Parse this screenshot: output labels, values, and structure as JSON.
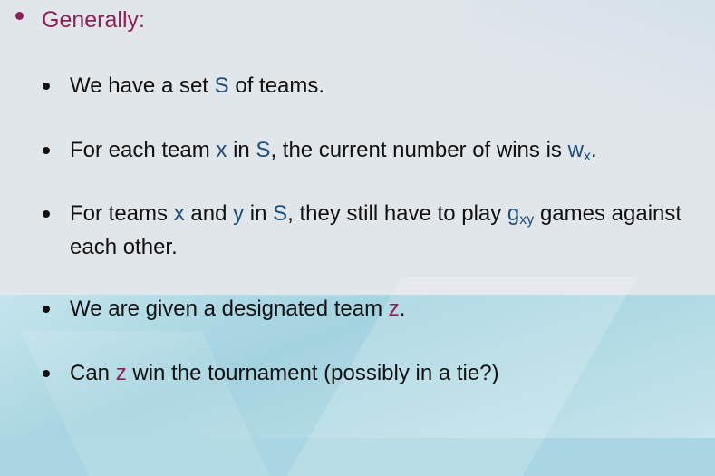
{
  "heading": "Generally:",
  "items": {
    "i1": {
      "a": "We have a set ",
      "s": "S",
      "b": " of teams."
    },
    "i2": {
      "a": "For each team ",
      "x": "x",
      "b": " in ",
      "s": "S",
      "c": ", the current number of wins is ",
      "w": "w",
      "wsub": "x",
      "d": "."
    },
    "i3": {
      "a": "For teams ",
      "x": "x",
      "b": " and ",
      "y": "y",
      "c": " in ",
      "s": "S",
      "d": ", they still have to play ",
      "g": "g",
      "gsub": "xy",
      "e": " games against each other."
    },
    "i4": {
      "a": "We are given a designated team ",
      "z": "z",
      "b": "."
    },
    "i5": {
      "a": "Can ",
      "z": "z",
      "b": " win the tournament (possibly in a tie?)"
    }
  },
  "colors": {
    "heading": "#8e1f57",
    "variable_blue": "#1f4e79",
    "variable_magenta": "#8e1f57",
    "text": "#111111"
  }
}
